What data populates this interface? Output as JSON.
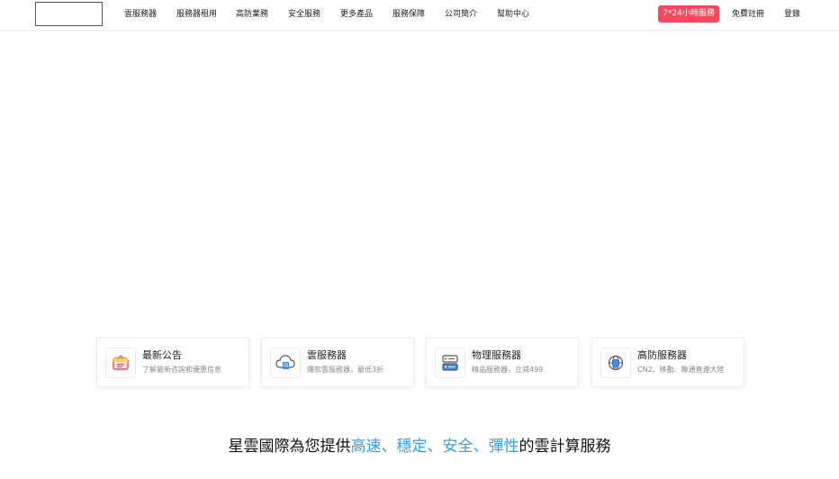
{
  "header": {
    "nav": [
      "雲服務器",
      "服務器租用",
      "高防業務",
      "安全服務",
      "更多產品",
      "服務保障",
      "公司簡介",
      "幫助中心"
    ],
    "hotline": "7*24小時服務",
    "register": "免費註冊",
    "login": "登錄"
  },
  "cards": [
    {
      "title": "最新公告",
      "desc": "了解最新咨詢和優惠信息",
      "icon": "announcement-icon"
    },
    {
      "title": "雲服務器",
      "desc": "爆款雲服務器，最低3折",
      "icon": "cloud-server-icon"
    },
    {
      "title": "物理服務器",
      "desc": "精品服務器，立減499",
      "icon": "physical-server-icon"
    },
    {
      "title": "高防服務器",
      "desc": "CN2、移動、聯通直連大陸",
      "icon": "globe-shield-icon"
    }
  ],
  "slogan": {
    "prefix": "星雲國際為您提供",
    "hl1": "高速",
    "sep1": "、",
    "hl2": "穩定",
    "sep2": "、",
    "hl3": "安全",
    "sep3": "、",
    "hl4": "彈性",
    "suffix": "的雲計算服務"
  },
  "colors": {
    "accent_red": "#f5475f",
    "accent_blue": "#2ba3e3"
  }
}
